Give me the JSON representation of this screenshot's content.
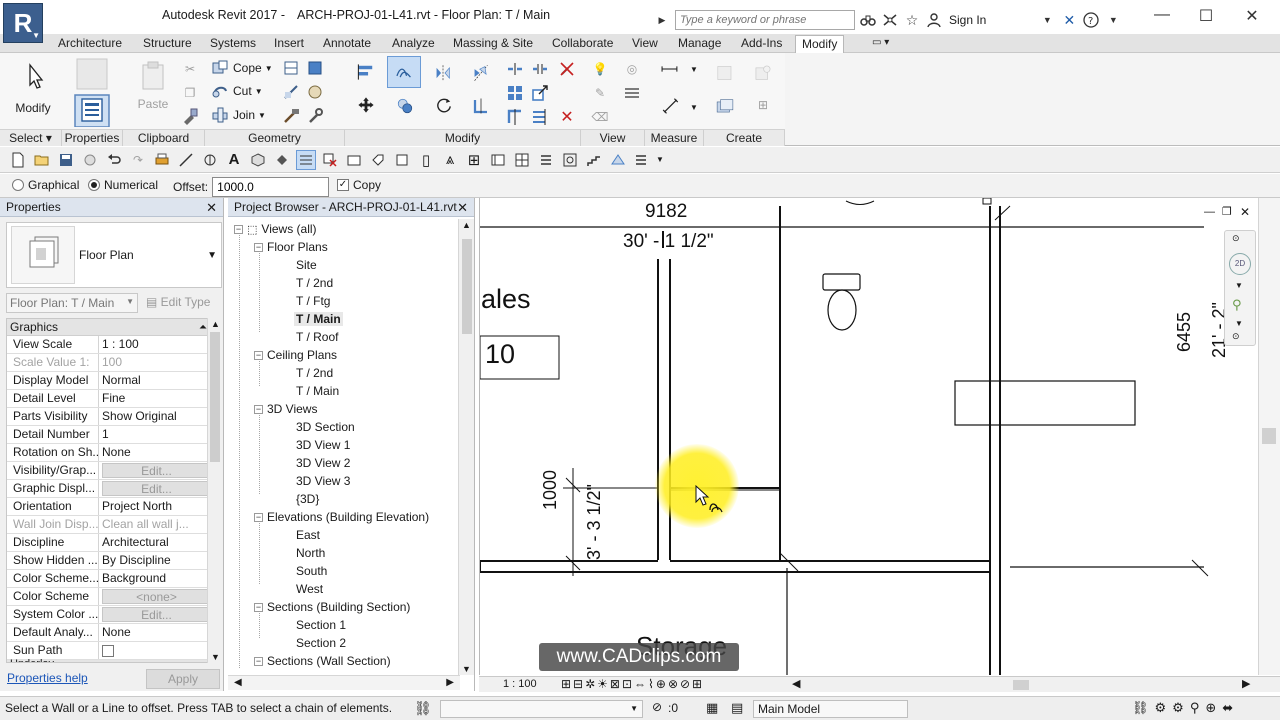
{
  "app": {
    "logo_letter": "R",
    "product": "Autodesk Revit 2017  -",
    "document": "ARCH-PROJ-01-L41.rvt - Floor Plan: T / Main"
  },
  "infocenter": {
    "search_placeholder": "Type a keyword or phrase",
    "sign_in": "Sign In"
  },
  "ribbon_tabs": [
    "Architecture",
    "Structure",
    "Systems",
    "Insert",
    "Annotate",
    "Analyze",
    "Massing & Site",
    "Collaborate",
    "View",
    "Manage",
    "Add-Ins",
    "Modify"
  ],
  "ribbon": {
    "modify_label": "Modify",
    "paste_label": "Paste",
    "cope_label": "Cope",
    "cut_label": "Cut",
    "join_label": "Join",
    "panels": {
      "select": "Select",
      "properties": "Properties",
      "clipboard": "Clipboard",
      "geometry": "Geometry",
      "modify": "Modify",
      "view": "View",
      "measure": "Measure",
      "create": "Create"
    }
  },
  "options_bar": {
    "graphical": "Graphical",
    "numerical": "Numerical",
    "offset_label": "Offset:",
    "offset_value": "1000.0",
    "copy_label": "Copy"
  },
  "properties": {
    "title": "Properties",
    "type_name": "Floor Plan",
    "instance_selector": "Floor Plan: T / Main",
    "edit_type": "Edit Type",
    "group_graphics": "Graphics",
    "rows": [
      {
        "key": "View Scale",
        "value": "1 : 100"
      },
      {
        "key": "Scale Value    1:",
        "value": "100"
      },
      {
        "key": "Display Model",
        "value": "Normal"
      },
      {
        "key": "Detail Level",
        "value": "Fine"
      },
      {
        "key": "Parts Visibility",
        "value": "Show Original"
      },
      {
        "key": "Detail Number",
        "value": "1"
      },
      {
        "key": "Rotation on Sh...",
        "value": "None"
      },
      {
        "key": "Visibility/Grap...",
        "value": "Edit..."
      },
      {
        "key": "Graphic Displ...",
        "value": "Edit..."
      },
      {
        "key": "Orientation",
        "value": "Project North"
      },
      {
        "key": "Wall Join Disp...",
        "value": "Clean all wall j..."
      },
      {
        "key": "Discipline",
        "value": "Architectural"
      },
      {
        "key": "Show Hidden ...",
        "value": "By Discipline"
      },
      {
        "key": "Color Scheme...",
        "value": "Background"
      },
      {
        "key": "Color Scheme",
        "value": "<none>"
      },
      {
        "key": "System Color ...",
        "value": "Edit..."
      },
      {
        "key": "Default Analy...",
        "value": "None"
      },
      {
        "key": "Sun Path",
        "value": ""
      },
      {
        "key": "Underlay",
        "value": ""
      }
    ],
    "help_link": "Properties help",
    "apply": "Apply"
  },
  "browser": {
    "title": "Project Browser - ARCH-PROJ-01-L41.rvt",
    "nodes": [
      {
        "label": "Views (all)",
        "level": 0
      },
      {
        "label": "Floor Plans",
        "level": 1
      },
      {
        "label": "Site",
        "level": 2
      },
      {
        "label": "T / 2nd",
        "level": 2
      },
      {
        "label": "T / Ftg",
        "level": 2
      },
      {
        "label": "T / Main",
        "level": 2
      },
      {
        "label": "T / Roof",
        "level": 2
      },
      {
        "label": "Ceiling Plans",
        "level": 1
      },
      {
        "label": "T / 2nd",
        "level": 2
      },
      {
        "label": "T / Main",
        "level": 2
      },
      {
        "label": "3D Views",
        "level": 1
      },
      {
        "label": "3D Section",
        "level": 2
      },
      {
        "label": "3D View 1",
        "level": 2
      },
      {
        "label": "3D View 2",
        "level": 2
      },
      {
        "label": "3D View 3",
        "level": 2
      },
      {
        "label": "{3D}",
        "level": 2
      },
      {
        "label": "Elevations (Building Elevation)",
        "level": 1
      },
      {
        "label": "East",
        "level": 2
      },
      {
        "label": "North",
        "level": 2
      },
      {
        "label": "South",
        "level": 2
      },
      {
        "label": "West",
        "level": 2
      },
      {
        "label": "Sections (Building Section)",
        "level": 1
      },
      {
        "label": "Section 1",
        "level": 2
      },
      {
        "label": "Section 2",
        "level": 2
      },
      {
        "label": "Sections (Wall Section)",
        "level": 1
      }
    ]
  },
  "drawing": {
    "dim_top_mm": "9182",
    "dim_top_imperial": "30' - 1 1/2\"",
    "room_name_partial": "ales",
    "room_number_partial": "10",
    "dim_left_mm": "1000",
    "dim_left_imperial": "3' - 3 1/2\"",
    "dim_right_mm": "6455",
    "dim_right_imperial": "21' - 2\"",
    "storage_label": "Storage"
  },
  "view_control": {
    "scale": "1 : 100"
  },
  "watermark": "www.CADclips.com",
  "status": {
    "message": "Select a Wall or a Line to offset. Press TAB to select a chain of elements.",
    "count": ":0",
    "model": "Main Model"
  },
  "colors": {
    "tab_bg": "#e3e3e3",
    "header_blue": "#dde4ee",
    "logo_blue": "#3c5f8e",
    "highlight_yellow": "#fff028"
  }
}
